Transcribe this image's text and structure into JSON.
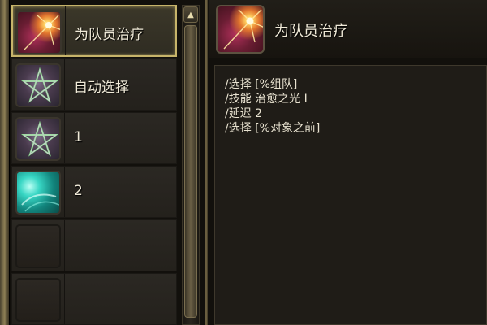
{
  "macro_list": {
    "items": [
      {
        "label": "为队员治疗",
        "icon": "heal-burst-icon",
        "selected": true
      },
      {
        "label": "自动选择",
        "icon": "pentagram-icon",
        "selected": false
      },
      {
        "label": "1",
        "icon": "pentagram-icon",
        "selected": false
      },
      {
        "label": "2",
        "icon": "teal-swirl-icon",
        "selected": false
      },
      {
        "label": "",
        "icon": "empty-slot-icon",
        "selected": false
      },
      {
        "label": "",
        "icon": "empty-slot-icon",
        "selected": false
      }
    ]
  },
  "scrollbar": {
    "up_arrow": "▲"
  },
  "detail": {
    "title": "为队员治疗",
    "icon": "heal-burst-icon",
    "lines": [
      "/选择 [%组队]",
      "/技能 治愈之光 I",
      "/延迟 2",
      "/选择 [%对象之前]"
    ]
  },
  "colors": {
    "selected_border": "#c7b46a",
    "background": "#12100c",
    "text": "#f0ead8"
  }
}
